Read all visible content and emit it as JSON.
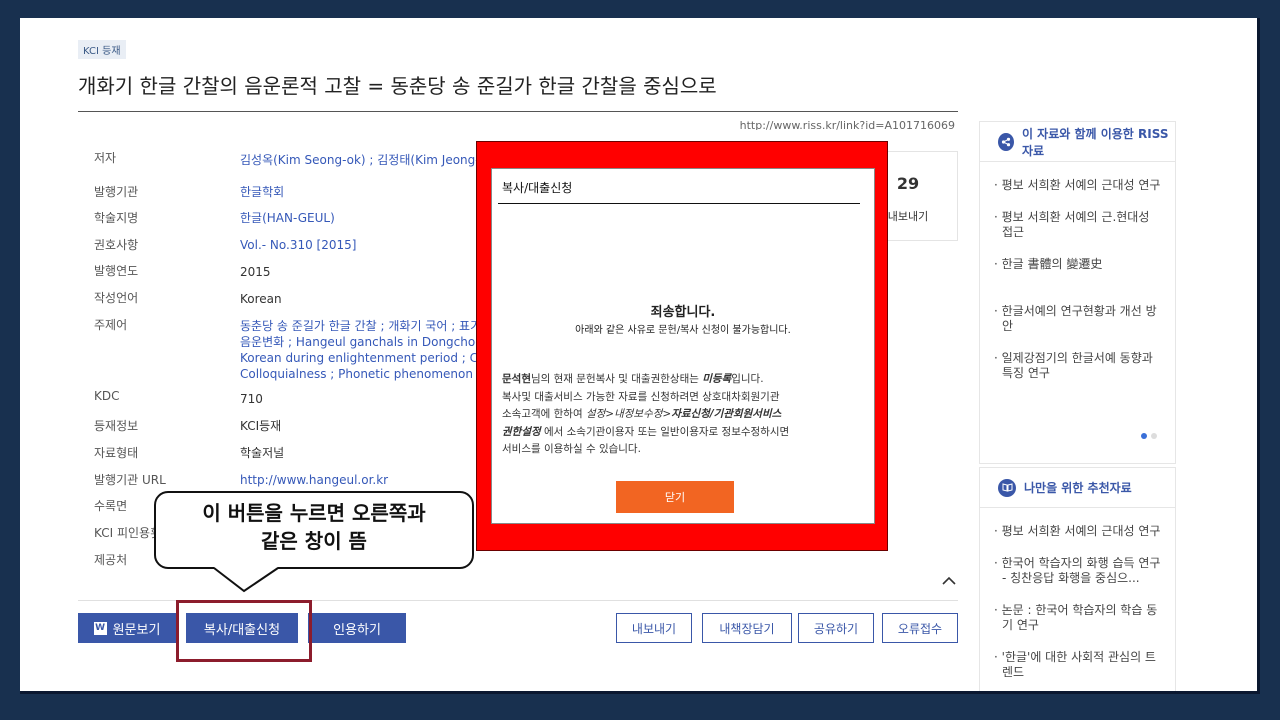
{
  "article": {
    "badge": "KCI 등재",
    "title": "개화기 한글 간찰의 음운론적 고찰 = 동춘당 송 준길가 한글 간찰을 중심으로",
    "url": "http://www.riss.kr/link?id=A101716069"
  },
  "meta": {
    "author_label": "저자",
    "author_value": "김성옥(Kim Seong-ok) ; 김정태(Kim Jeong-tae",
    "publisher_label": "발행기관",
    "publisher_value": "한글학회",
    "journal_label": "학술지명",
    "journal_value": "한글(HAN-GEUL)",
    "volume_label": "권호사항",
    "volume_value": "Vol.- No.310 [2015]",
    "year_label": "발행연도",
    "year_value": "2015",
    "lang_label": "작성언어",
    "lang_value": "Korean",
    "subject_label": "주제어",
    "subject_line1": "동춘당 송 준길가 한글 간찰 ; 개화기 국어 ; 표기",
    "subject_line2": "음운변화 ; Hangeul ganchals in Dongchoonda",
    "subject_line3": "Korean during enlightenment period ; Conser",
    "subject_line4": "Colloquialness ; Phonetic phenomenon ; Pho",
    "kdc_label": "KDC",
    "kdc_value": "710",
    "reg_label": "등재정보",
    "reg_value": "KCI등재",
    "type_label": "자료형태",
    "type_value": "학술저널",
    "puburl_label": "발행기관 URL",
    "puburl_value": "http://www.hangeul.or.kr",
    "pages_label": "수록면",
    "kci_label": "KCI 피인용횟",
    "provider_label": "제공처"
  },
  "counter": {
    "value": "29",
    "label": "내보내기"
  },
  "actions": {
    "view_original": "원문보기",
    "copy_loan": "복사/대출신청",
    "cite": "인용하기",
    "export": "내보내기",
    "save_shelf": "내책장담기",
    "share": "공유하기",
    "report_error": "오류접수"
  },
  "related": {
    "title": "이 자료와 함께 이용한 RISS 자료",
    "items": [
      "평보 서희환 서예의 근대성 연구",
      "평보 서희환 서예의 근.현대성 접근",
      "한글 書體의 變遷史",
      "한글서예의 연구현황과 개선 방안",
      "일제강점기의 한글서예 동향과 특징 연구"
    ]
  },
  "recommend": {
    "title": "나만을 위한 추천자료",
    "items": [
      "평보 서희환 서예의 근대성 연구",
      "한국어 학습자의 화행 습득 연구 - 칭찬응답 화행을 중심으...",
      "논문 : 한국어 학습자의 학습 동기 연구",
      "'한글'에 대한 사회적 관심의 트렌드"
    ]
  },
  "modal": {
    "title": "복사/대출신청",
    "sorry": "죄송합니다.",
    "reason": "아래와 같은 사유로 문헌/복사 신청이 불가능합니다.",
    "user": "문석현",
    "line1_a": "님의 현재 문헌복사 및 대출권한상태는 ",
    "status": "미등록",
    "line1_b": "입니다.",
    "line2": "복사및 대출서비스 가능한 자료를 신청하려면 상호대차회원기관",
    "line3_a": "소속고객에 한하여 ",
    "path1": "설정>내정보수정>",
    "path2": "자료신청/기관회원서비스",
    "path3": "권한설정",
    "line4_b": " 에서 소속기관이용자 또는 일반이용자로 정보수정하시면",
    "line5": "서비스를 이용하실 수 있습니다.",
    "close": "닫기"
  },
  "annotation": {
    "line1": "이 버튼을 누르면 오른쪽과",
    "line2": "같은 창이 뜸"
  }
}
